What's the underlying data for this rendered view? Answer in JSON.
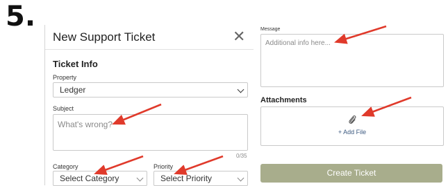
{
  "step": {
    "number": "5."
  },
  "ticket": {
    "title": "New Support Ticket",
    "close_symbol": "✕",
    "section_info": "Ticket Info",
    "property": {
      "label": "Property",
      "value": "Ledger"
    },
    "subject": {
      "label": "Subject",
      "placeholder": "What's wrong?",
      "counter": "0/35"
    },
    "category": {
      "label": "Category",
      "value": "Select Category"
    },
    "priority": {
      "label": "Priority",
      "value": "Select Priority"
    }
  },
  "right": {
    "message": {
      "label": "Message",
      "placeholder": "Additional info here..."
    },
    "attachments": {
      "label": "Attachments",
      "add_file": "+ Add File"
    },
    "create_button": "Create Ticket"
  },
  "colors": {
    "annotation_arrow": "#e03a2b",
    "button_bg": "#a8ad8c",
    "link": "#3c5a80"
  }
}
